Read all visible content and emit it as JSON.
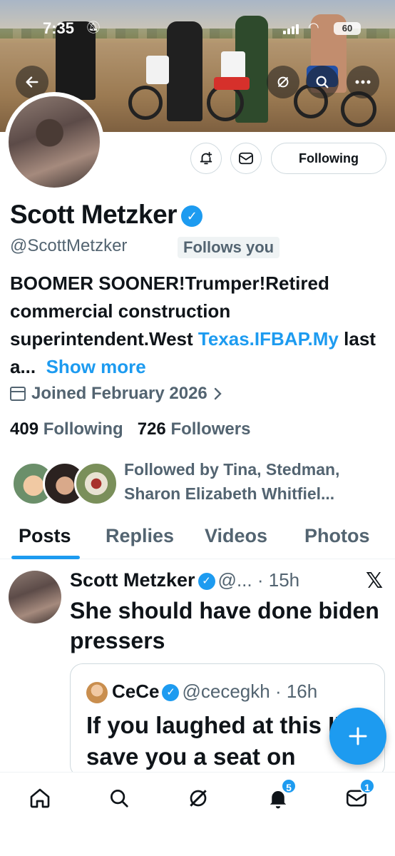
{
  "status_bar": {
    "time": "7:35",
    "battery": "60"
  },
  "profile": {
    "name": "Scott Metzker",
    "handle": "@ScottMetzker",
    "follows_you": "Follows you",
    "bio_part1": "BOOMER SOONER!Trumper!Retired commercial construction superintendent.West ",
    "bio_link": "Texas.IFBAP.My",
    "bio_part2": " last a...",
    "show_more": "Show more",
    "joined": "Joined February 2026",
    "following_count": "409",
    "following_label": "Following",
    "followers_count": "726",
    "followers_label": "Followers",
    "followed_by": "Followed by Tina, Stedman, Sharon Elizabeth Whitfiel..."
  },
  "actions": {
    "following_button": "Following"
  },
  "tabs": [
    {
      "label": "Posts",
      "active": true
    },
    {
      "label": "Replies",
      "active": false
    },
    {
      "label": "Videos",
      "active": false
    },
    {
      "label": "Photos",
      "active": false
    }
  ],
  "post": {
    "author": "Scott Metzker",
    "handle": "@...",
    "time": "15h",
    "text": "She should have done biden pressers",
    "quote": {
      "author": "CeCe",
      "handle": "@cecegkh",
      "time": "16h",
      "text": "If you laughed at this I'll save you a seat on"
    }
  },
  "nav": {
    "notifications_badge": "5",
    "messages_badge": "1"
  },
  "colors": {
    "accent": "#1d9bf0",
    "text": "#0f1419",
    "secondary": "#536471"
  },
  "icons": [
    "back-arrow-icon",
    "grok-icon",
    "search-icon",
    "more-icon",
    "notification-add-icon",
    "mail-icon",
    "verified-icon",
    "calendar-icon",
    "chevron-right-icon",
    "x-logo-icon",
    "compose-plus-icon",
    "home-icon",
    "bell-icon"
  ]
}
